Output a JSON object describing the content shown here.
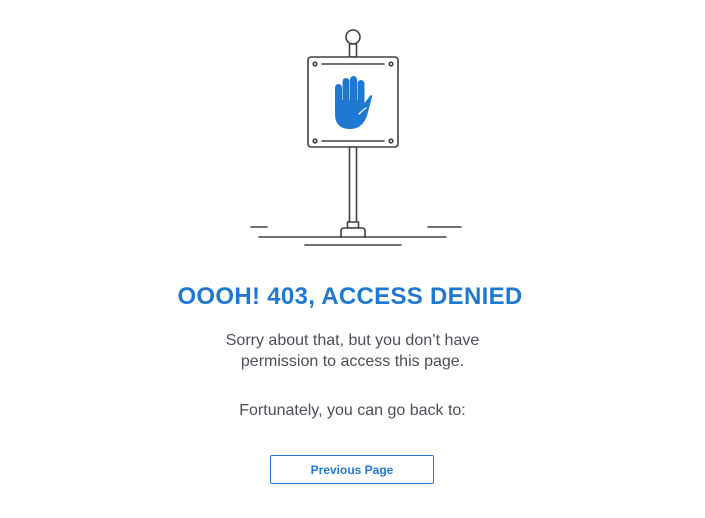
{
  "colors": {
    "accent": "#1f78d1",
    "text": "#4a4f57",
    "line": "#3d4047",
    "background": "#ffffff"
  },
  "illustration": {
    "icon": "stop-hand-icon"
  },
  "error": {
    "title": "OOOH! 403, ACCESS DENIED",
    "message_line1": "Sorry about that, but you don’t have",
    "message_line2": "permission to access this page.",
    "fallback_text": "Fortunately, you can go back to:"
  },
  "actions": {
    "previous_page_label": "Previous Page"
  }
}
